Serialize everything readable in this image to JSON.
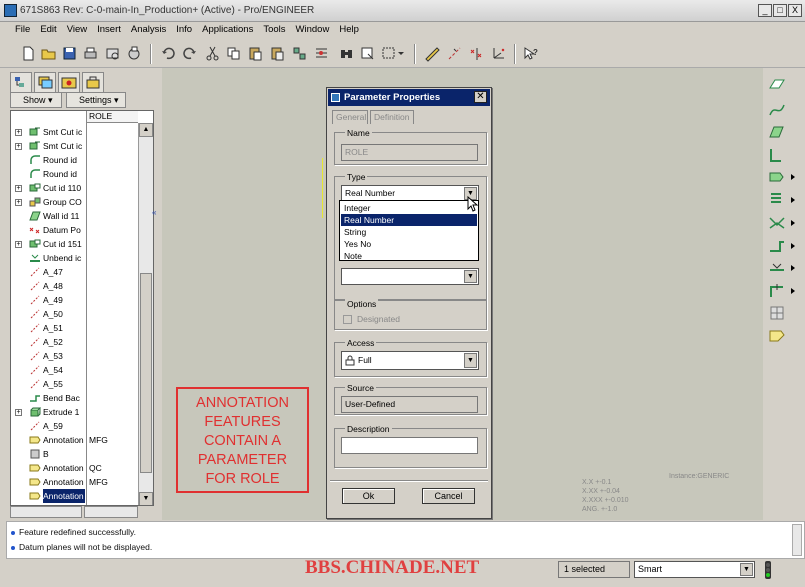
{
  "window": {
    "title": "671S863 Rev: C-0-main-In_Production+ (Active) - Pro/ENGINEER",
    "minimize": "_",
    "restore": "□",
    "close": "X"
  },
  "menu": [
    "File",
    "Edit",
    "View",
    "Insert",
    "Analysis",
    "Info",
    "Applications",
    "Tools",
    "Window",
    "Help"
  ],
  "left_panel": {
    "show_label": "Show ▾",
    "settings_label": "Settings ▾",
    "column_header": "ROLE",
    "rows": [
      {
        "label": "Smt Cut ic",
        "role": "",
        "exp": "+",
        "icon": "sheetmetal-cut-icon"
      },
      {
        "label": "Smt Cut ic",
        "role": "",
        "exp": "+",
        "icon": "sheetmetal-cut-icon"
      },
      {
        "label": "Round id",
        "role": "",
        "exp": "",
        "icon": "round-icon"
      },
      {
        "label": "Round id",
        "role": "",
        "exp": "",
        "icon": "round-icon"
      },
      {
        "label": "Cut id 110",
        "role": "",
        "exp": "+",
        "icon": "cut-icon"
      },
      {
        "label": "Group CO",
        "role": "",
        "exp": "+",
        "icon": "group-icon"
      },
      {
        "label": "Wall id 11",
        "role": "",
        "exp": "",
        "icon": "wall-icon"
      },
      {
        "label": "Datum Po",
        "role": "",
        "exp": "",
        "icon": "datum-point-icon"
      },
      {
        "label": "Cut id 151",
        "role": "",
        "exp": "+",
        "icon": "cut-icon"
      },
      {
        "label": "Unbend ic",
        "role": "",
        "exp": "",
        "icon": "unbend-icon"
      },
      {
        "label": "A_47",
        "role": "",
        "exp": "",
        "icon": "axis-icon"
      },
      {
        "label": "A_48",
        "role": "",
        "exp": "",
        "icon": "axis-icon"
      },
      {
        "label": "A_49",
        "role": "",
        "exp": "",
        "icon": "axis-icon"
      },
      {
        "label": "A_50",
        "role": "",
        "exp": "",
        "icon": "axis-icon"
      },
      {
        "label": "A_51",
        "role": "",
        "exp": "",
        "icon": "axis-icon"
      },
      {
        "label": "A_52",
        "role": "",
        "exp": "",
        "icon": "axis-icon"
      },
      {
        "label": "A_53",
        "role": "",
        "exp": "",
        "icon": "axis-icon"
      },
      {
        "label": "A_54",
        "role": "",
        "exp": "",
        "icon": "axis-icon"
      },
      {
        "label": "A_55",
        "role": "",
        "exp": "",
        "icon": "axis-icon"
      },
      {
        "label": "Bend Bac",
        "role": "",
        "exp": "",
        "icon": "bend-icon"
      },
      {
        "label": "Extrude 1",
        "role": "",
        "exp": "+",
        "icon": "extrude-icon"
      },
      {
        "label": "A_59",
        "role": "",
        "exp": "",
        "icon": "axis-icon"
      },
      {
        "label": "Annotation",
        "role": "MFG",
        "exp": "",
        "icon": "annotation-icon"
      },
      {
        "label": "B",
        "role": "",
        "exp": "",
        "icon": "datum-icon"
      },
      {
        "label": "Annotation",
        "role": "QC",
        "exp": "",
        "icon": "annotation-icon"
      },
      {
        "label": "Annotation",
        "role": "MFG",
        "exp": "",
        "icon": "annotation-icon"
      },
      {
        "label": "Annotation",
        "role": "",
        "exp": "",
        "icon": "annotation-icon",
        "selected": true
      }
    ]
  },
  "dialog": {
    "title": "Parameter Properties",
    "tab_general": "General",
    "tab_definition": "Definition",
    "name_label": "Name",
    "name_value": "ROLE",
    "type_label": "Type",
    "type_value": "Real Number",
    "type_options": [
      "Integer",
      "Real Number",
      "String",
      "Yes No",
      "Note"
    ],
    "type_selected_index": 1,
    "options_label": "Options",
    "designated_label": "Designated",
    "access_label": "Access",
    "access_value": "Full",
    "source_label": "Source",
    "source_value": "User-Defined",
    "description_label": "Description",
    "description_value": "",
    "ok": "Ok",
    "cancel": "Cancel"
  },
  "annotation_box": {
    "lines": [
      "ANNOTATION",
      "FEATURES",
      "CONTAIN A",
      "PARAMETER",
      "FOR ROLE"
    ],
    "color": "#e03030"
  },
  "canvas_text": {
    "tolerances": [
      "X.X +-0.1",
      "X.XX +-0.04",
      "X.XXX +-0.010",
      "ANG. +-1.0"
    ],
    "instance": "Instance:GENERIC"
  },
  "status": {
    "messages": [
      "Feature redefined successfully.",
      "Datum planes will not be displayed."
    ]
  },
  "bottom": {
    "watermark": "BBS.CHINADE.NET",
    "selected": "1 selected",
    "filter": "Smart"
  },
  "colors": {
    "title_active": "#0a246a",
    "selection": "#0a246a",
    "annotation_red": "#e03030",
    "canvas": "#c7c7bb"
  }
}
